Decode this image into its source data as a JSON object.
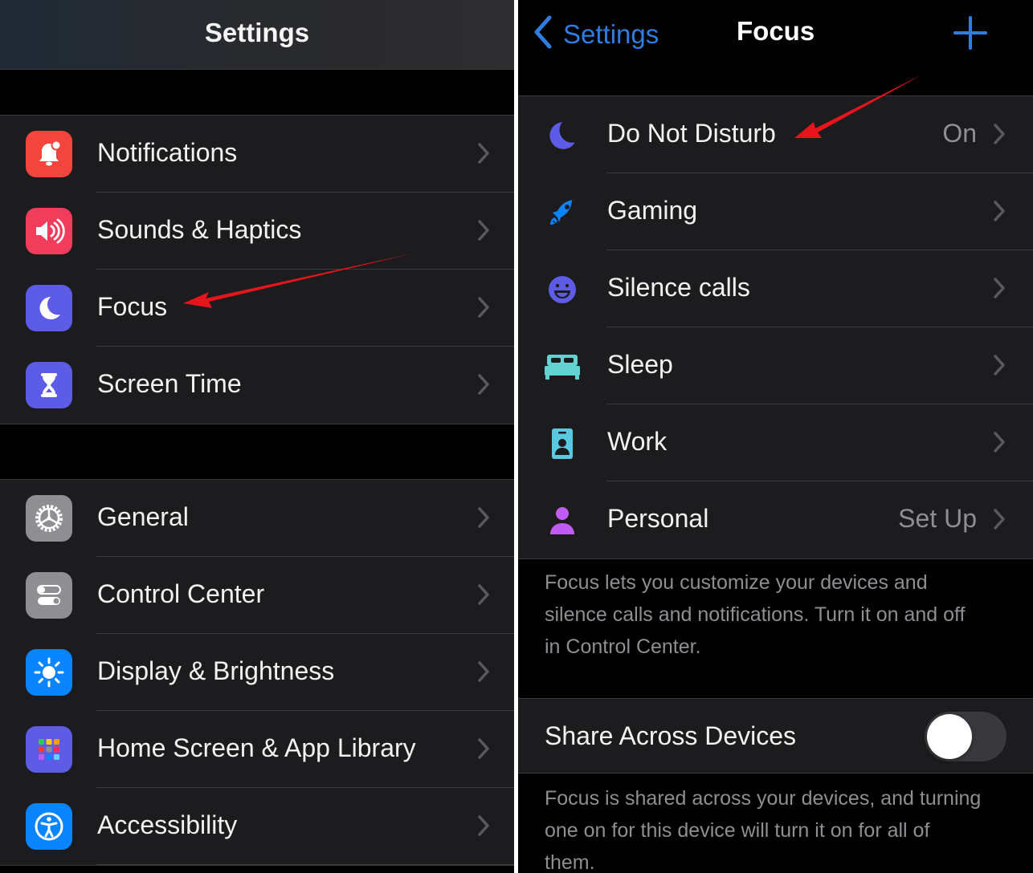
{
  "settings": {
    "title": "Settings",
    "group1": [
      {
        "label": "Notifications",
        "icon": "notifications-bell-icon",
        "color": "#f2453d"
      },
      {
        "label": "Sounds & Haptics",
        "icon": "speaker-icon",
        "color": "#f23c5c"
      },
      {
        "label": "Focus",
        "icon": "moon-icon",
        "color": "#5d5ce6"
      },
      {
        "label": "Screen Time",
        "icon": "hourglass-icon",
        "color": "#5d5ce6"
      }
    ],
    "group2": [
      {
        "label": "General",
        "icon": "gear-icon",
        "color": "#8e8e93"
      },
      {
        "label": "Control Center",
        "icon": "toggles-icon",
        "color": "#8e8e93"
      },
      {
        "label": "Display & Brightness",
        "icon": "sun-icon",
        "color": "#0a84ff"
      },
      {
        "label": "Home Screen & App Library",
        "icon": "app-grid-icon",
        "color": "#5e5ce6"
      },
      {
        "label": "Accessibility",
        "icon": "accessibility-icon",
        "color": "#0a84ff"
      }
    ]
  },
  "focus": {
    "back_label": "Settings",
    "title": "Focus",
    "add_icon": "plus-icon",
    "items": [
      {
        "label": "Do Not Disturb",
        "value": "On",
        "icon": "moon-icon",
        "color": "#5e5ce6"
      },
      {
        "label": "Gaming",
        "value": "",
        "icon": "rocket-icon",
        "color": "#0a84ff"
      },
      {
        "label": "Silence calls",
        "value": "",
        "icon": "smiley-icon",
        "color": "#5e5ce6"
      },
      {
        "label": "Sleep",
        "value": "",
        "icon": "bed-icon",
        "color": "#64d2d0"
      },
      {
        "label": "Work",
        "value": "",
        "icon": "id-badge-icon",
        "color": "#5ac8e0"
      },
      {
        "label": "Personal",
        "value": "Set Up",
        "icon": "person-icon",
        "color": "#bf5af2"
      }
    ],
    "description": "Focus lets you customize your devices and silence calls and notifications. Turn it on and off in Control Center.",
    "share_label": "Share Across Devices",
    "share_enabled": false,
    "share_description": "Focus is shared across your devices, and turning one on for this device will turn it on for all of them."
  },
  "colors": {
    "accent": "#2f7de0",
    "annotation_arrow": "#e8141b"
  }
}
